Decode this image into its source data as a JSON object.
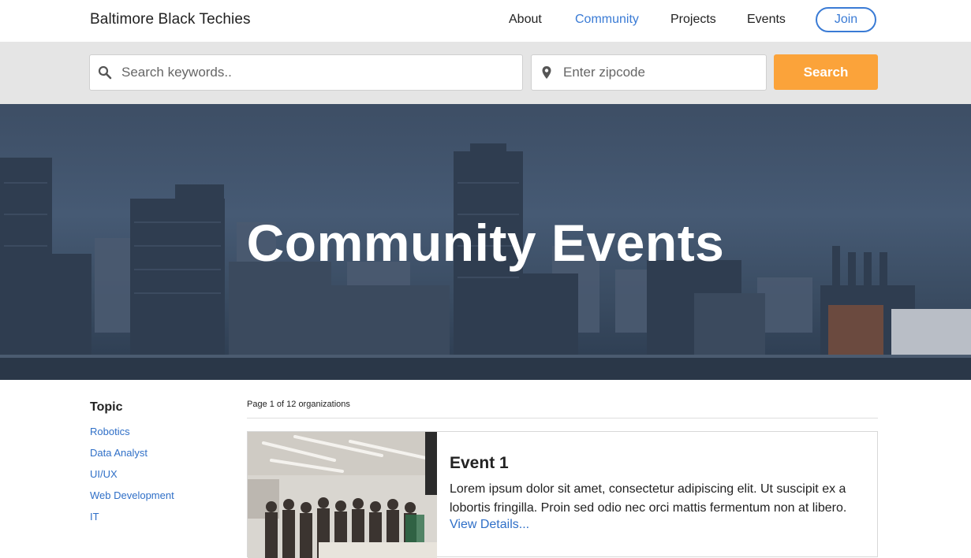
{
  "header": {
    "brand": "Baltimore Black Techies",
    "nav": [
      {
        "label": "About",
        "active": false
      },
      {
        "label": "Community",
        "active": true
      },
      {
        "label": "Projects",
        "active": false
      },
      {
        "label": "Events",
        "active": false
      }
    ],
    "join_label": "Join"
  },
  "search": {
    "keywords_placeholder": "Search keywords..",
    "zip_placeholder": "Enter zipcode",
    "button_label": "Search",
    "icons": {
      "keywords": "search-icon",
      "zip": "map-pin-icon"
    }
  },
  "hero": {
    "title": "Community Events"
  },
  "sidebar": {
    "heading": "Topic",
    "topics": [
      "Robotics",
      "Data Analyst",
      "UI/UX",
      "Web Development",
      "IT"
    ]
  },
  "results": {
    "pagination": "Page 1 of 12 organizations",
    "events": [
      {
        "title": "Event 1",
        "description": "Lorem ipsum dolor sit amet, consectetur adipiscing elit. Ut suscipit ex a lobortis fringilla. Proin sed odio nec orci mattis fermentum non at libero.",
        "link_label": "View Details..."
      }
    ]
  },
  "colors": {
    "accent_blue": "#3a7bd5",
    "search_orange": "#fba33a",
    "link_blue": "#2f6fc7",
    "searchbar_bg": "#e5e5e5"
  }
}
